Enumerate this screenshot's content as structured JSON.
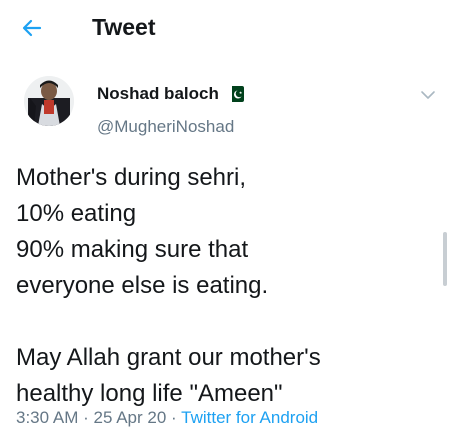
{
  "header": {
    "title": "Tweet",
    "back_icon": "arrow-left-icon",
    "accent": "#1da1f2"
  },
  "author": {
    "name": "Noshad baloch",
    "handle": "@MugheriNoshad",
    "badge_icon": "pakistan-flag-icon",
    "badge_color": "#01411c"
  },
  "tweet": {
    "text": "Mother's during sehri,\n10% eating\n90% making sure that\neveryone else is eating.\n\nMay Allah grant our mother's\nhealthy long life \"Ameen\"",
    "time": "3:30 AM",
    "date": "25 Apr 20",
    "separator": "·",
    "source": "Twitter for Android",
    "menu_icon": "chevron-down-icon"
  },
  "colors": {
    "text": "#14171a",
    "secondary": "#657786",
    "link": "#1da1f2"
  }
}
